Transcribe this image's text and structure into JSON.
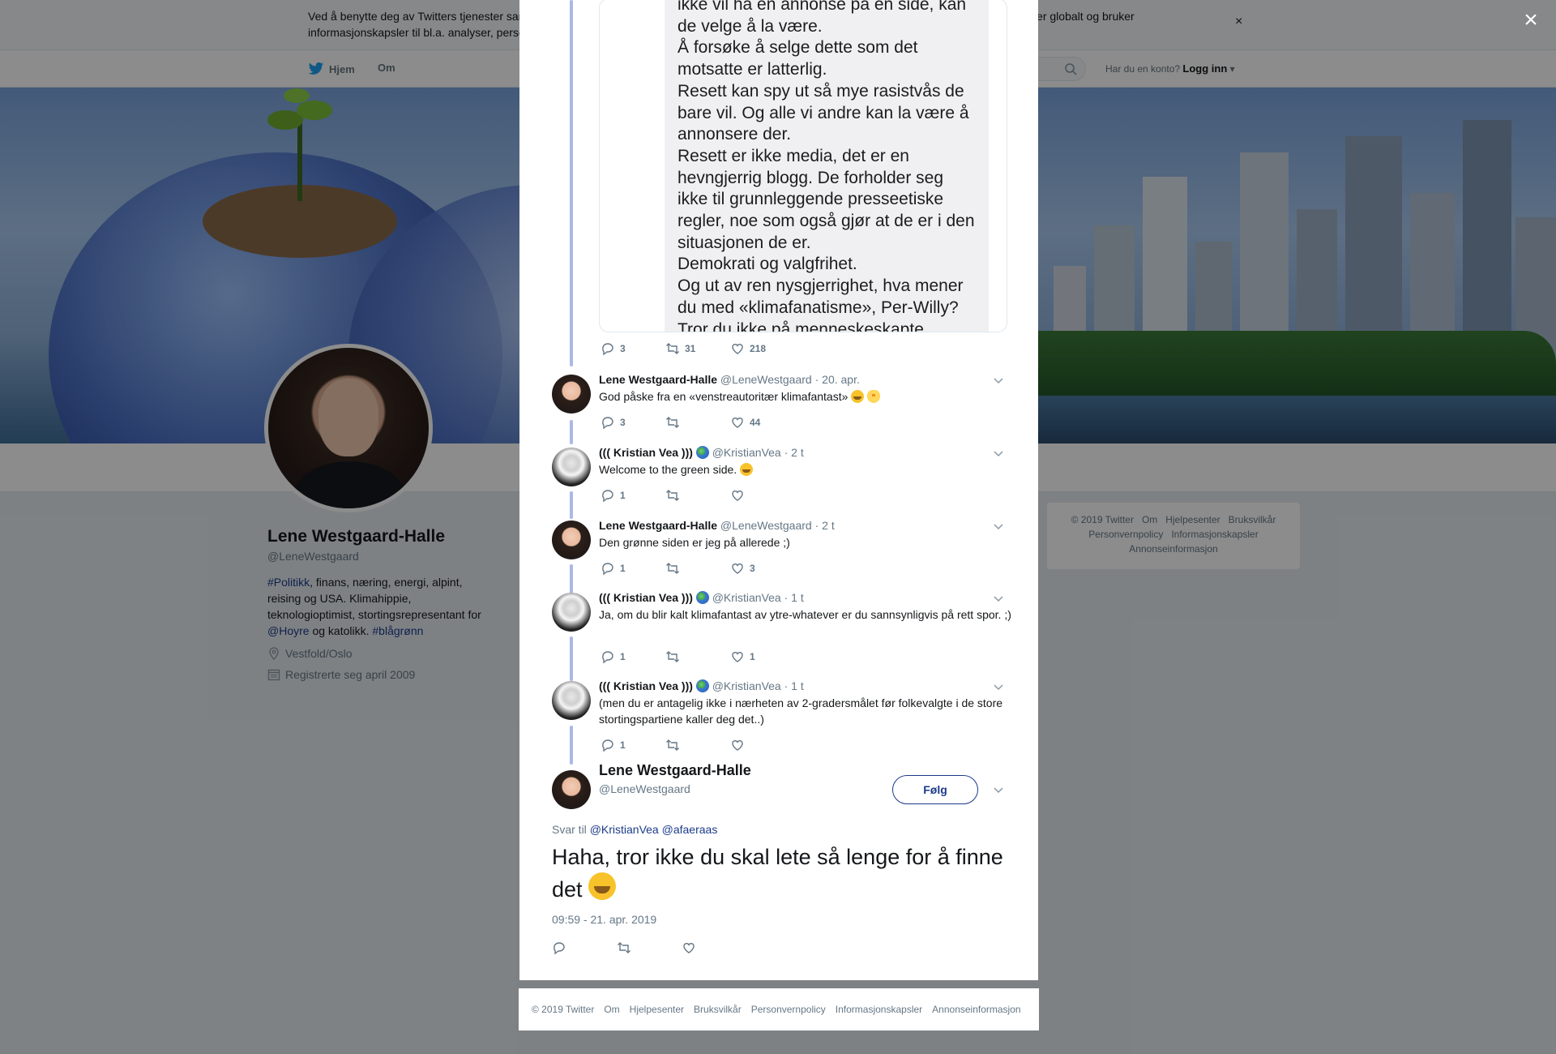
{
  "cookie_bar": {
    "text": "Ved å benytte deg av Twitters tjenester samtykker du til vår bruk av informasjonskapsler og dataoverføring utenfor EU. Vi og våre partnere opererer globalt og bruker informasjonskapsler til bl.a. analyser, personalisering og annonser.",
    "close": "×"
  },
  "topnav": {
    "home": "Hjem",
    "about": "Om",
    "account_prompt": "Har du en konto?",
    "login": "Logg inn"
  },
  "profile": {
    "name": "Lene Westgaard-Halle",
    "handle": "@LeneWestgaard",
    "bio_hashtag1": "#Politikk",
    "bio_text1": ", finans, næring, energi, alpint, reising og USA. Klimahippie, teknologioptimist, stortingsrepresentant for ",
    "bio_mention": "@Hoyre",
    "bio_text2": " og katolikk. ",
    "bio_hashtag2": "#blågrønn",
    "location": "Vestfold/Oslo",
    "joined": "Registrerte seg april 2009"
  },
  "footer_right": [
    "© 2019 Twitter",
    "Om",
    "Hjelpesenter",
    "Bruksvilkår",
    "Personvernpolicy",
    "Informasjonskapsler",
    "Annonseinformasjon"
  ],
  "overlay": {
    "close": "×"
  },
  "image_tweet": {
    "image_text": "ikke vil ha en annonse på en side, kan de velge å la være.\nÅ forsøke å selge dette som det motsatte er latterlig.\nResett kan spy ut så mye rasistvås de bare vil. Og alle vi andre kan la være å annonsere der.\nResett er ikke media, det er en hevngjerrig blogg. De forholder seg ikke til grunnleggende presseetiske regler, noe som også gjør at de er i den situasjonen de er.\nDemokrati og valgfrihet.\nOg ut av ren nysgjerrighet, hva mener du med «klimafanatisme», Per-Willy?\nTror du ikke på menneskeskapte",
    "replies": "3",
    "retweets": "31",
    "likes": "218"
  },
  "tweets": [
    {
      "name": "Lene Westgaard-Halle",
      "handle": "@LeneWestgaard",
      "time": "· 20. apr.",
      "text": "God påske fra en «venstreautoritær klimafantast» ",
      "replies": "3",
      "retweets": "",
      "likes": "44"
    },
    {
      "name": "((( Kristian Vea )))",
      "handle": "@KristianVea",
      "time": "· 2 t",
      "text": "Welcome to the green side. ",
      "replies": "1",
      "retweets": "",
      "likes": ""
    },
    {
      "name": "Lene Westgaard-Halle",
      "handle": "@LeneWestgaard",
      "time": "· 2 t",
      "text": "Den grønne siden er jeg på allerede ;)",
      "replies": "1",
      "retweets": "",
      "likes": "3"
    },
    {
      "name": "((( Kristian Vea )))",
      "handle": "@KristianVea",
      "time": "· 1 t",
      "text": "Ja, om du blir kalt klimafantast av ytre-whatever er du sannsynligvis på rett spor. ;)",
      "replies": "1",
      "retweets": "",
      "likes": "1"
    },
    {
      "name": "((( Kristian Vea )))",
      "handle": "@KristianVea",
      "time": "· 1 t",
      "text": "(men du er antagelig ikke i nærheten av 2-gradersmålet før folkevalgte i de store stortingspartiene kaller deg det..)",
      "replies": "1",
      "retweets": "",
      "likes": ""
    }
  ],
  "main_tweet": {
    "name": "Lene Westgaard-Halle",
    "handle": "@LeneWestgaard",
    "follow": "Følg",
    "reply_prefix": "Svar til",
    "reply_mention1": "@KristianVea",
    "reply_mention2": "@afaeraas",
    "text": "Haha, tror ikke du skal lete så lenge for å finne det ",
    "timestamp": "09:59 - 21. apr. 2019"
  },
  "modal_footer": [
    "© 2019 Twitter",
    "Om",
    "Hjelpesenter",
    "Bruksvilkår",
    "Personvernpolicy",
    "Informasjonskapsler",
    "Annonseinformasjon"
  ],
  "colors": {
    "link": "#1b3a8a",
    "thread_line": "#aab8e6",
    "muted": "#657786"
  }
}
